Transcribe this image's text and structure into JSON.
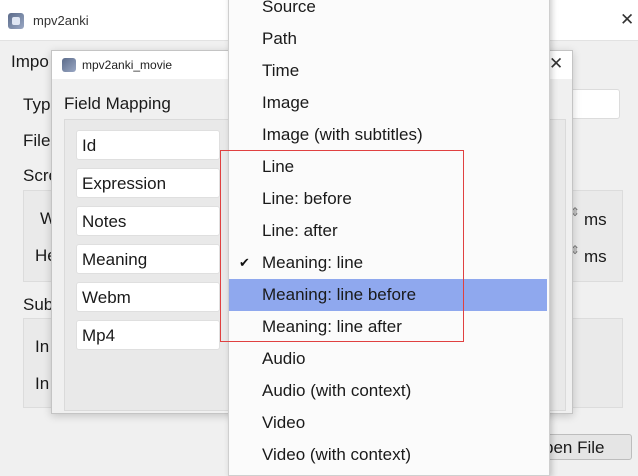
{
  "main_window": {
    "title": "mpv2anki",
    "left_labels": [
      "Impo",
      "Typ",
      "File",
      "Scre",
      "W",
      "He",
      "Sub",
      "In",
      "In"
    ],
    "units": [
      "ms",
      "ms"
    ],
    "open_file_label": "pen File"
  },
  "dialog": {
    "title": "mpv2anki_movie",
    "field_mapping_title": "Field Mapping",
    "fields": [
      "Id",
      "Expression",
      "Notes",
      "Meaning",
      "Webm",
      "Mp4"
    ]
  },
  "dropdown": {
    "items": [
      "Source",
      "Path",
      "Time",
      "Image",
      "Image (with subtitles)",
      "Line",
      "Line: before",
      "Line: after",
      "Meaning: line",
      "Meaning: line before",
      "Meaning: line after",
      "Audio",
      "Audio (with context)",
      "Video",
      "Video (with context)"
    ],
    "checked_item": "Meaning: line",
    "highlighted_item": "Meaning: line before",
    "highlight_color": "#8fa8ee",
    "annotation_color": "#e04040"
  }
}
